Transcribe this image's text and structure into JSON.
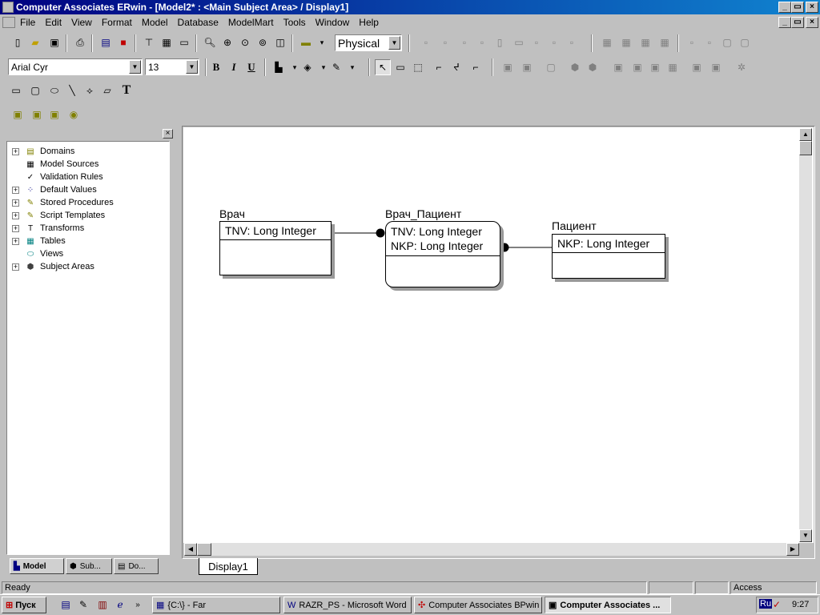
{
  "window": {
    "title": "Computer Associates ERwin - [Model2* : <Main Subject Area> / Display1]"
  },
  "menu": [
    "File",
    "Edit",
    "View",
    "Format",
    "Model",
    "Database",
    "ModelMart",
    "Tools",
    "Window",
    "Help"
  ],
  "toolbar": {
    "view_mode": "Physical",
    "font_name": "Arial Cyr",
    "font_size": "13",
    "bold": "B",
    "italic": "I",
    "underline": "U",
    "text_tool": "T"
  },
  "tree": {
    "items": [
      {
        "label": "Domains",
        "icon": "domains-icon",
        "expandable": true
      },
      {
        "label": "Model Sources",
        "icon": "model-sources-icon",
        "expandable": false
      },
      {
        "label": "Validation Rules",
        "icon": "validation-rules-icon",
        "expandable": false
      },
      {
        "label": "Default Values",
        "icon": "default-values-icon",
        "expandable": true
      },
      {
        "label": "Stored Procedures",
        "icon": "stored-procedures-icon",
        "expandable": true
      },
      {
        "label": "Script Templates",
        "icon": "script-templates-icon",
        "expandable": true
      },
      {
        "label": "Transforms",
        "icon": "transforms-icon",
        "expandable": true
      },
      {
        "label": "Tables",
        "icon": "tables-icon",
        "expandable": true
      },
      {
        "label": "Views",
        "icon": "views-icon",
        "expandable": false
      },
      {
        "label": "Subject Areas",
        "icon": "subject-areas-icon",
        "expandable": true
      }
    ]
  },
  "explorer_tabs": [
    "Model",
    "Sub...",
    "Do..."
  ],
  "diagram": {
    "entities": [
      {
        "name": "Врач",
        "keys": [
          "TNV: Long Integer"
        ]
      },
      {
        "name": "Врач_Пациент",
        "keys": [
          "TNV: Long Integer",
          "NKP: Long Integer"
        ]
      },
      {
        "name": "Пациент",
        "keys": [
          "NKP: Long Integer"
        ]
      }
    ]
  },
  "display_tab": "Display1",
  "status": {
    "left": "Ready",
    "access": "Access"
  },
  "taskbar": {
    "start_label": "Пуск",
    "tasks": [
      "{C:\\} - Far",
      "RAZR_PS - Microsoft Word",
      "Computer Associates BPwin",
      "Computer Associates ..."
    ],
    "language": "Ru",
    "clock": "9:27"
  }
}
